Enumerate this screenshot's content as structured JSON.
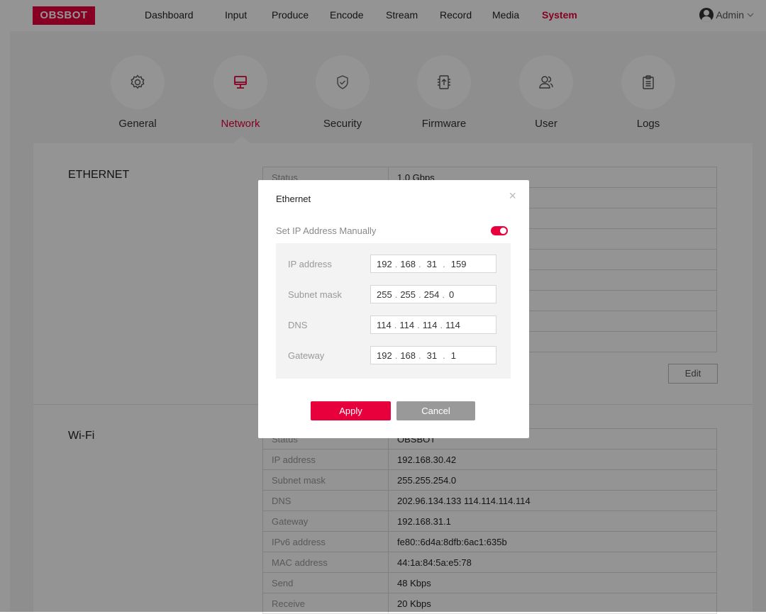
{
  "brand": {
    "logo_text": "OBSBOT",
    "accent_color": "#e8003d"
  },
  "nav": {
    "items": [
      "Dashboard",
      "Input",
      "Produce",
      "Encode",
      "Stream",
      "Record",
      "Media",
      "System"
    ],
    "active": "System",
    "user": "Admin"
  },
  "tabs": [
    {
      "label": "General",
      "icon": "gear-icon"
    },
    {
      "label": "Network",
      "icon": "monitor-icon",
      "active": true
    },
    {
      "label": "Security",
      "icon": "shield-check-icon"
    },
    {
      "label": "Firmware",
      "icon": "firmware-upload-icon"
    },
    {
      "label": "User",
      "icon": "users-icon"
    },
    {
      "label": "Logs",
      "icon": "clipboard-icon"
    }
  ],
  "ethernet": {
    "title": "ETHERNET",
    "rows": [
      {
        "key": "Status",
        "value": "1.0 Gbps"
      }
    ],
    "edit_label": "Edit"
  },
  "wifi": {
    "title": "Wi-Fi",
    "rows": [
      {
        "key": "Status",
        "value": "OBSBOT"
      },
      {
        "key": "IP address",
        "value": "192.168.30.42"
      },
      {
        "key": "Subnet mask",
        "value": "255.255.254.0"
      },
      {
        "key": "DNS",
        "value": "202.96.134.133 114.114.114.114"
      },
      {
        "key": "Gateway",
        "value": "192.168.31.1"
      },
      {
        "key": "IPv6 address",
        "value": "fe80::6d4a:8dfb:6ac1:635b"
      },
      {
        "key": "MAC address",
        "value": "44:1a:84:5a:e5:78"
      },
      {
        "key": "Send",
        "value": "48 Kbps"
      },
      {
        "key": "Receive",
        "value": "20 Kbps"
      }
    ]
  },
  "modal": {
    "title": "Ethernet",
    "close_symbol": "×",
    "manual_label": "Set IP Address Manually",
    "manual_enabled": true,
    "fields": [
      {
        "label": "IP address",
        "octets": [
          "192",
          "168",
          "31",
          "159"
        ]
      },
      {
        "label": "Subnet mask",
        "octets": [
          "255",
          "255",
          "254",
          "0"
        ]
      },
      {
        "label": "DNS",
        "octets": [
          "114",
          "114",
          "114",
          "114"
        ]
      },
      {
        "label": "Gateway",
        "octets": [
          "192",
          "168",
          "31",
          "1"
        ]
      }
    ],
    "apply_label": "Apply",
    "cancel_label": "Cancel"
  }
}
